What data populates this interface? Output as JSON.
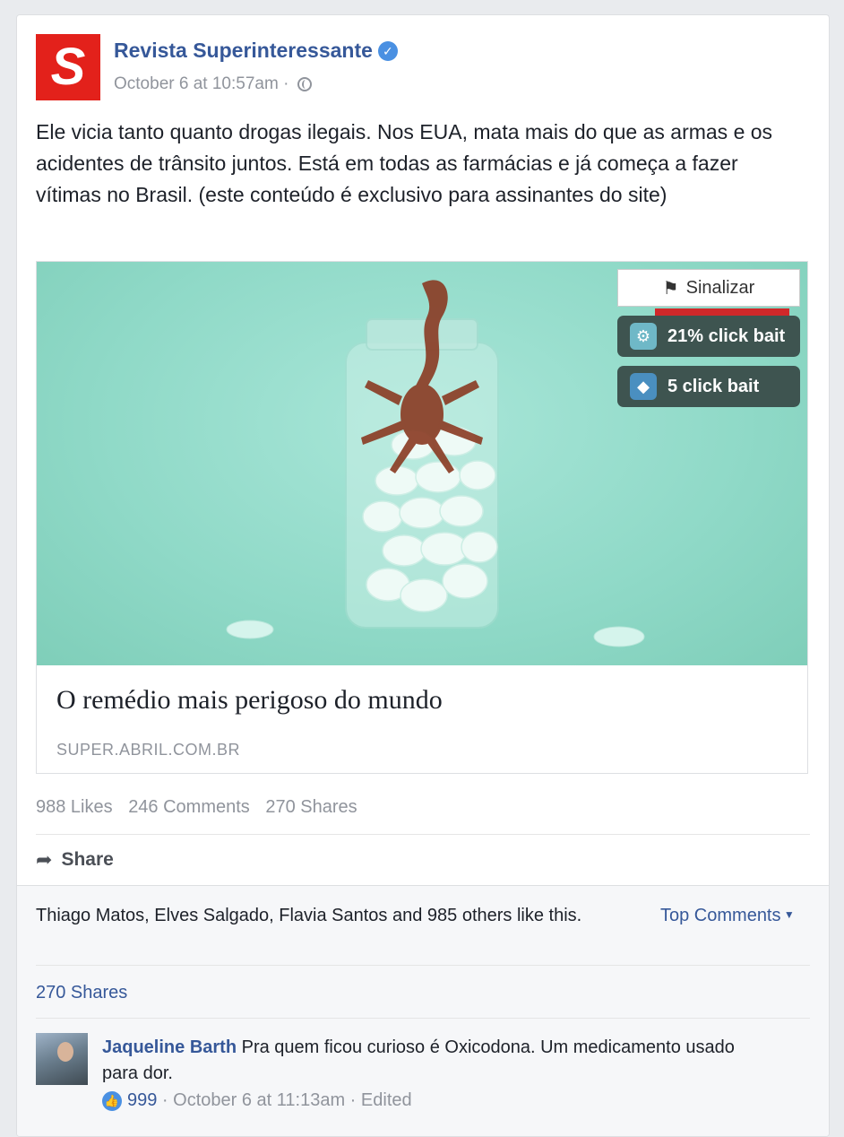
{
  "post": {
    "page_name": "Revista Superinteressante",
    "timestamp": "October 6 at 10:57am",
    "separator": "·",
    "text": "Ele vicia tanto quanto drogas ilegais. Nos EUA, mata mais do que as armas e os acidentes de trânsito juntos. Está em todas as farmácias e já começa a fazer vítimas no Brasil. (este conteúdo é exclusivo para assinantes do site)"
  },
  "link": {
    "title": "O remédio mais perigoso do mundo",
    "domain": "SUPER.ABRIL.COM.BR",
    "flag_label": "Sinalizar",
    "badges": [
      {
        "label": "21% click bait",
        "icon": "robot-icon"
      },
      {
        "label": "5 click bait",
        "icon": "fish-icon"
      }
    ]
  },
  "stats": {
    "likes": "988 Likes",
    "comments": "246 Comments",
    "shares": "270 Shares"
  },
  "actions": {
    "share_label": "Share"
  },
  "comments_section": {
    "likers_text": "Thiago Matos, Elves Salgado, Flavia Santos and 985 others like this.",
    "sort_label": "Top Comments",
    "shares_link": "270 Shares",
    "comment": {
      "author": "Jaqueline Barth",
      "text": "Pra quem ficou curioso é Oxicodona. Um medicamento usado para dor.",
      "likes": "999",
      "timestamp": "October 6 at 11:13am",
      "edited": "Edited"
    }
  },
  "colors": {
    "brand_red": "#e3211b",
    "link_blue": "#365899",
    "badge_bg": "#3e5450",
    "image_teal": "#8fd9c7"
  }
}
